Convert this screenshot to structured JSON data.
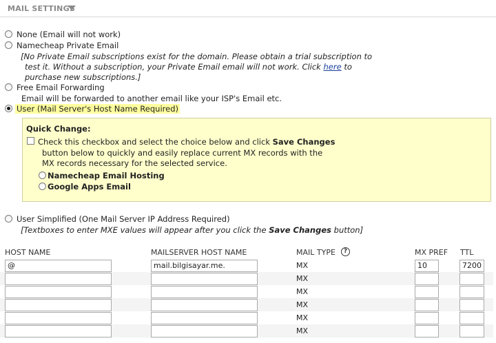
{
  "header": {
    "title": "MAIL SETTINGS",
    "chevron_icon": "chevron-down-icon"
  },
  "options": {
    "none": {
      "label": "None (Email will not work)"
    },
    "private_email": {
      "label": "Namecheap Private Email",
      "note_line1": "[No Private Email subscriptions exist for the domain. Please obtain a trial subscription to",
      "note_line2_pre": "test it. Without a subscription, your Private Email email will not work. Click ",
      "note_link": "here",
      "note_line2_post": " to",
      "note_line3": "purchase new subscriptions.]"
    },
    "forwarding": {
      "label": "Free Email Forwarding",
      "desc": "Email will be forwarded to another email like your ISP's Email etc."
    },
    "user": {
      "label": "User (Mail Server's Host Name Required)",
      "selected": true
    },
    "user_simplified": {
      "label": "User Simplified (One Mail Server IP Address Required)",
      "note_pre": "[Textboxes to enter MXE values will appear after you click the ",
      "note_bold": "Save Changes",
      "note_post": " button]"
    }
  },
  "quick_change": {
    "title": "Quick Change:",
    "line1_pre": "Check this checkbox and select the choice below and click ",
    "line1_bold": "Save Changes",
    "line2": "button below to quickly and easily replace current MX records with the",
    "line3": "MX records necessary for the selected service.",
    "choice1": "Namecheap Email Hosting",
    "choice2": "Google Apps Email"
  },
  "table": {
    "headers": {
      "host_name": "HOST NAME",
      "mailserver_host_name": "MAILSERVER HOST NAME",
      "mail_type": "MAIL TYPE",
      "mx_pref": "MX PREF",
      "ttl": "TTL"
    },
    "help_icon": "?",
    "rows": [
      {
        "host": "@",
        "mailserver": "mail.bilgisayar.me.",
        "type": "MX",
        "pref": "10",
        "ttl": "7200"
      },
      {
        "host": "",
        "mailserver": "",
        "type": "MX",
        "pref": "",
        "ttl": ""
      },
      {
        "host": "",
        "mailserver": "",
        "type": "MX",
        "pref": "",
        "ttl": ""
      },
      {
        "host": "",
        "mailserver": "",
        "type": "MX",
        "pref": "",
        "ttl": ""
      },
      {
        "host": "",
        "mailserver": "",
        "type": "MX",
        "pref": "",
        "ttl": ""
      },
      {
        "host": "",
        "mailserver": "",
        "type": "MX",
        "pref": "",
        "ttl": ""
      }
    ]
  }
}
